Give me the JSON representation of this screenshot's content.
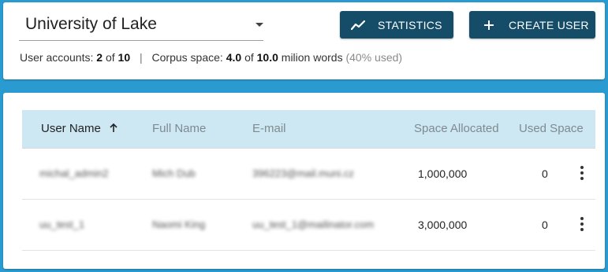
{
  "org_selector": {
    "value": "University of Lake"
  },
  "toolbar": {
    "statistics_label": "STATISTICS",
    "create_user_label": "CREATE USER"
  },
  "summary": {
    "accounts_label": "User accounts:",
    "accounts_used": "2",
    "of1": "of",
    "accounts_total": "10",
    "separator": "|",
    "corpus_label": "Corpus space:",
    "corpus_used": "4.0",
    "of2": "of",
    "corpus_total": "10.0",
    "corpus_unit": "milion words",
    "corpus_percent": "(40% used)"
  },
  "table": {
    "columns": [
      "User Name",
      "Full Name",
      "E-mail",
      "Space Allocated",
      "Used Space"
    ],
    "sorted_column": "User Name",
    "sort_direction": "ascending",
    "rows": [
      {
        "username": "michal_admin2",
        "fullname": "Mich Dub",
        "email": "396223@mail.muni.cz",
        "space_allocated": "1,000,000",
        "used_space": "0"
      },
      {
        "username": "uu_test_1",
        "fullname": "Naomi King",
        "email": "uu_test_1@mailinator.com",
        "space_allocated": "3,000,000",
        "used_space": "0"
      }
    ]
  },
  "colors": {
    "background": "#2a9bd1",
    "button": "#154d68",
    "table_header": "#cde8f3"
  },
  "icons": [
    "chart-line-icon",
    "plus-icon",
    "arrow-up-icon",
    "more-vert-icon",
    "dropdown-caret-icon"
  ]
}
